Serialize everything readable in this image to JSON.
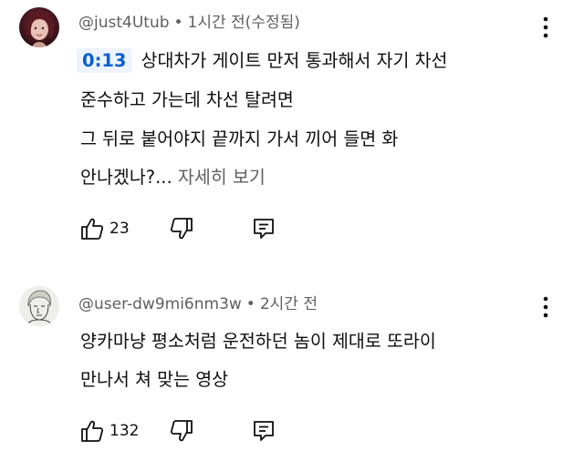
{
  "comments": [
    {
      "author": "@just4Utub",
      "separator": "•",
      "time": "1시간 전(수정됨)",
      "timestamp_link": "0:13",
      "lines": [
        "상대차가 게이트 만저 통과해서 자기 차선",
        "준수하고 가는데 차선 탈려면",
        "그 뒤로 붙어야지 끝까지 가서 끼어 들면 화",
        "안나겠나?..."
      ],
      "read_more": "자세히 보기",
      "likes": "23",
      "avatar_icon": "profile-photo-avatar",
      "colors": {
        "timestamp_bg": "#eef4ff",
        "timestamp_text": "#065fd4"
      }
    },
    {
      "author": "@user-dw9mi6nm3w",
      "separator": "•",
      "time": "2시간 전",
      "lines": [
        "양카마냥 평소처럼 운전하던 놈이 제대로 또라이",
        "만나서 쳐 맞는 영상"
      ],
      "likes": "132",
      "avatar_icon": "sketch-face-avatar"
    }
  ]
}
